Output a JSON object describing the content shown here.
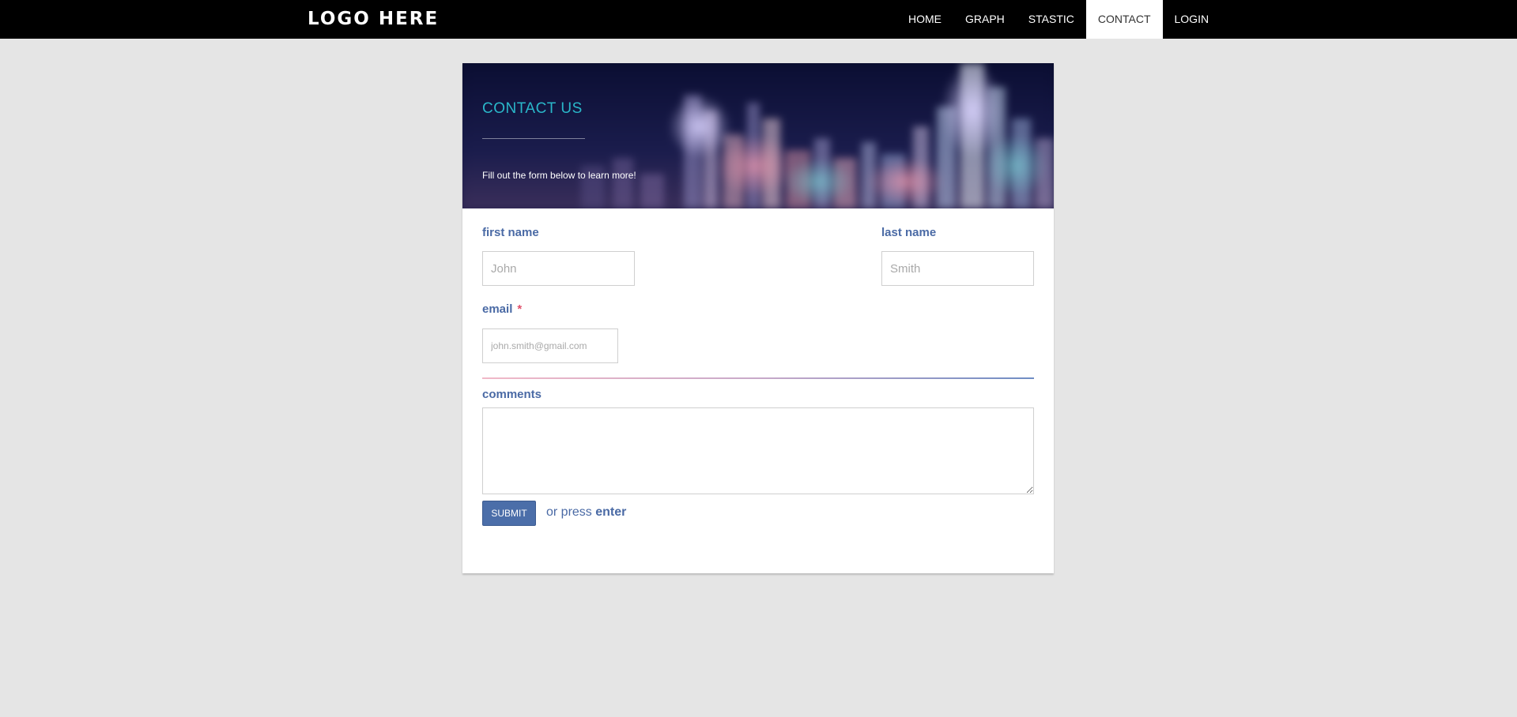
{
  "navbar": {
    "logo": "LOGO HERE",
    "links": [
      {
        "label": "HOME",
        "active": false
      },
      {
        "label": "GRAPH",
        "active": false
      },
      {
        "label": "STASTIC",
        "active": false
      },
      {
        "label": "CONTACT",
        "active": true
      },
      {
        "label": "LOGIN",
        "active": false
      }
    ]
  },
  "hero": {
    "title": "CONTACT US",
    "subtitle": "Fill out the form below to learn more!"
  },
  "form": {
    "first_name": {
      "label": "first name",
      "placeholder": "John",
      "value": ""
    },
    "last_name": {
      "label": "last name",
      "placeholder": "Smith",
      "value": ""
    },
    "email": {
      "label": "email",
      "required_mark": "*",
      "placeholder": "john.smith@gmail.com",
      "value": ""
    },
    "comments": {
      "label": "comments",
      "value": ""
    },
    "submit_label": "SUBMIT",
    "hint_prefix": "or press",
    "hint_key": "enter"
  },
  "colors": {
    "navbar_bg": "#000000",
    "page_bg": "#e5e5e5",
    "accent_label": "#4a6aa5",
    "hero_title": "#2ab7c9",
    "required": "#e0506a",
    "button_bg": "#4b6ea9"
  }
}
